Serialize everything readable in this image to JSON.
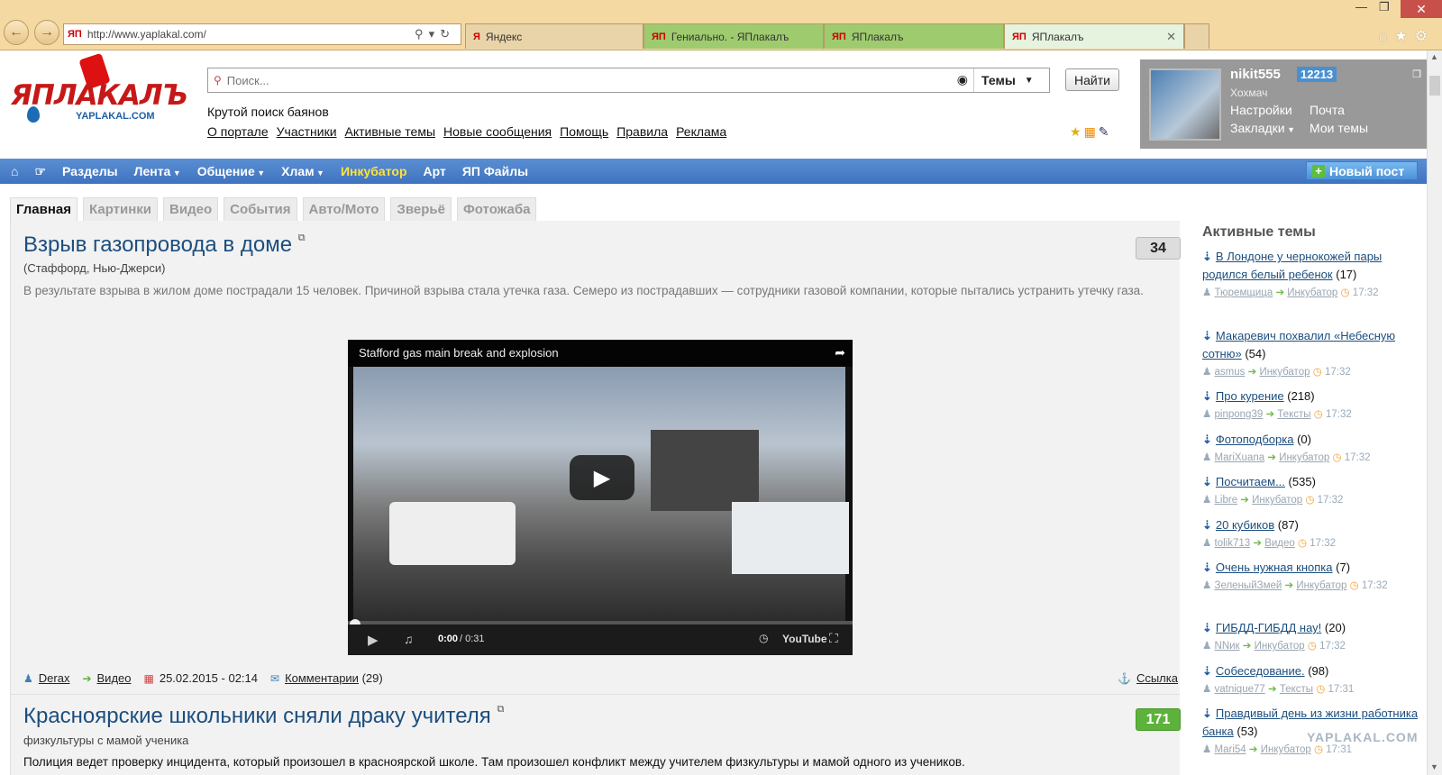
{
  "browser": {
    "url": "http://www.yaplakal.com/",
    "url_favicon": "ЯП",
    "tabs": [
      {
        "favicon": "Я",
        "label": "Яндекс"
      },
      {
        "favicon": "ЯП",
        "label": "Гениально. - ЯПлакалъ"
      },
      {
        "favicon": "ЯП",
        "label": "ЯПлакалъ"
      },
      {
        "favicon": "ЯП",
        "label": "ЯПлакалъ"
      }
    ]
  },
  "header": {
    "logo_text": "ЯПЛАКАЛЪ",
    "logo_sub": "YAPLAKAL.COM",
    "search_placeholder": "Поиск...",
    "search_scope": "Темы",
    "find_label": "Найти",
    "tagline": "Крутой поиск баянов",
    "links": [
      "О портале",
      "Участники",
      "Активные темы",
      "Новые сообщения",
      "Помощь",
      "Правила",
      "Реклама"
    ]
  },
  "user": {
    "name": "nikit555",
    "points": "12213",
    "rank": "Хохмач",
    "settings": "Настройки",
    "mail": "Почта",
    "bookmarks": "Закладки",
    "my_topics": "Мои темы"
  },
  "nav": {
    "items": [
      "Разделы",
      "Лента",
      "Общение",
      "Хлам",
      "Инкубатор",
      "Арт",
      "ЯП Файлы"
    ],
    "new_post": "Новый пост"
  },
  "content_tabs": [
    "Главная",
    "Картинки",
    "Видео",
    "События",
    "Авто/Мото",
    "Зверьё",
    "Фотожаба"
  ],
  "posts": [
    {
      "title": "Взрыв газопровода в доме",
      "subtitle": "(Стаффорд, Нью-Джерси)",
      "description": "В результате взрыва в жилом доме пострадали 15 человек. Причиной взрыва стала утечка газа. Семеро из пострадавших — сотрудники газовой компании, которые пытались устранить утечку газа.",
      "count": "34",
      "video_title": "Stafford gas main break and explosion",
      "video_time": "0:00",
      "video_duration": "/ 0:31",
      "author": "Derax",
      "section": "Видео",
      "date": "25.02.2015 - 02:14",
      "comments_label": "Комментарии",
      "comments_count": "(29)",
      "link_label": "Ссылка"
    },
    {
      "title": "Красноярские школьники сняли драку учителя",
      "subtitle": "физкультуры с мамой ученика",
      "description": "Полиция ведет проверку инцидента, который произошел в красноярской школе. Там произошел конфликт между учителем физкультуры и мамой одного из учеников.",
      "count": "171"
    }
  ],
  "sidebar": {
    "title": "Активные темы",
    "items": [
      {
        "title": "В Лондоне у чернокожей пары родился белый ребенок",
        "count": "(17)",
        "user": "Тюремщица",
        "section": "Инкубатор",
        "time": "17:32"
      },
      {
        "title": "Макаревич похвалил «Небесную сотню»",
        "count": "(54)",
        "user": "asmus",
        "section": "Инкубатор",
        "time": "17:32"
      },
      {
        "title": "Про курение",
        "count": "(218)",
        "user": "pinpong39",
        "section": "Тексты",
        "time": "17:32"
      },
      {
        "title": "Фотоподборка",
        "count": "(0)",
        "user": "MariXuana",
        "section": "Инкубатор",
        "time": "17:32"
      },
      {
        "title": "Посчитаем...",
        "count": "(535)",
        "user": "Libre",
        "section": "Инкубатор",
        "time": "17:32"
      },
      {
        "title": "20 кубиков",
        "count": "(87)",
        "user": "tolik713",
        "section": "Видео",
        "time": "17:32"
      },
      {
        "title": "Очень нужная кнопка",
        "count": "(7)",
        "user": "ЗеленыйЗмей",
        "section": "Инкубатор",
        "time": "17:32"
      },
      {
        "title": "ГИБДД-ГИБДД нау!",
        "count": "(20)",
        "user": "NNик",
        "section": "Инкубатор",
        "time": "17:32"
      },
      {
        "title": "Собеседование.",
        "count": "(98)",
        "user": "vatnique77",
        "section": "Тексты",
        "time": "17:31"
      },
      {
        "title": "Правдивый день из жизни работника банка",
        "count": "(53)",
        "user": "Mari54",
        "section": "Инкубатор",
        "time": "17:31"
      }
    ],
    "watermark": "YAPLAKAL.COM"
  },
  "colors": {
    "nav_bg": "#4a80c8",
    "accent_yellow": "#ffe23a",
    "title_blue": "#1c4e7e",
    "green_badge": "#5cb23a"
  }
}
